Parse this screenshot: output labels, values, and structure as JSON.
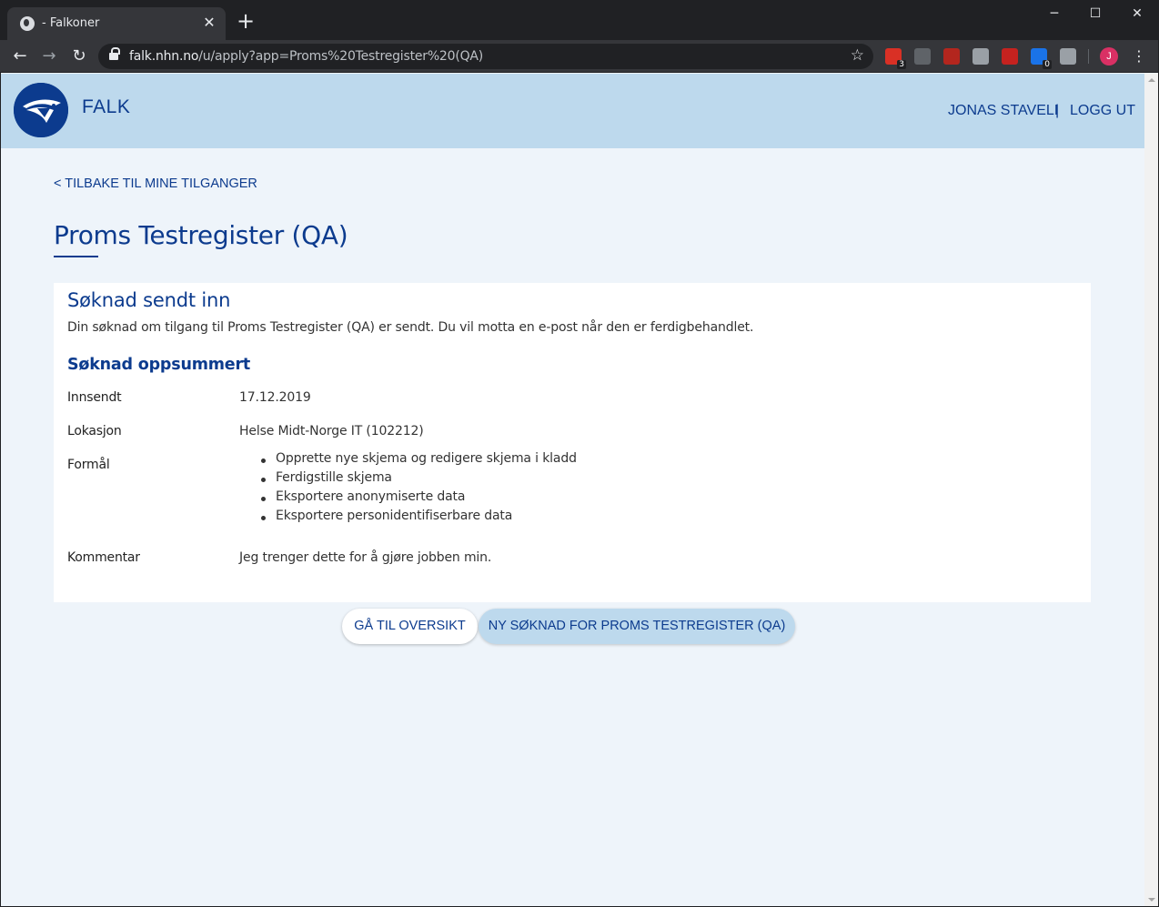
{
  "browser": {
    "tab_title": "- Falkoner",
    "tab_close": "✕",
    "new_tab": "+",
    "url_host": "falk.nhn.no",
    "url_path": "/u/apply?app=Proms%20Testregister%20(QA)",
    "window_controls": {
      "minimize": "─",
      "maximize": "☐",
      "close": "✕"
    },
    "nav": {
      "back": "←",
      "forward": "→",
      "reload": "↻"
    },
    "star": "☆",
    "extensions": [
      {
        "icon": "calendar-extension-icon",
        "color": "#d93025",
        "badge": "3"
      },
      {
        "icon": "grey-extension-icon",
        "color": "#5f6368",
        "badge": ""
      },
      {
        "icon": "pdf-extension-icon",
        "color": "#b3261e",
        "badge": ""
      },
      {
        "icon": "drive-extension-icon",
        "color": "#9aa0a6",
        "badge": ""
      },
      {
        "icon": "flag-extension-icon",
        "color": "#c5221f",
        "badge": ""
      },
      {
        "icon": "blue-extension-icon",
        "color": "#1a73e8",
        "badge": "0"
      },
      {
        "icon": "letter-extension-icon",
        "color": "#9aa0a6",
        "badge": ""
      }
    ],
    "profile_initial": "J",
    "menu": "⋮"
  },
  "header": {
    "brand": "FALK",
    "user_name": "JONAS STAVELI",
    "separator": "|",
    "logout": "LOGG UT"
  },
  "page": {
    "back_link": "< TILBAKE TIL MINE TILGANGER",
    "title": "Proms Testregister (QA)"
  },
  "card": {
    "title": "Søknad sendt inn",
    "description": "Din søknad om tilgang til Proms Testregister (QA) er sendt. Du vil motta en e-post når den er ferdigbehandlet.",
    "summary_title": "Søknad oppsummert",
    "submitted_label": "Innsendt",
    "submitted_value": "17.12.2019",
    "location_label": "Lokasjon",
    "location_value": "Helse Midt-Norge IT (102212)",
    "purpose_label": "Formål",
    "purposes": [
      "Opprette nye skjema og redigere skjema i kladd",
      "Ferdigstille skjema",
      "Eksportere anonymiserte data",
      "Eksportere personidentifiserbare data"
    ],
    "comment_label": "Kommentar",
    "comment_value": "Jeg trenger dette for å gjøre jobben min."
  },
  "buttons": {
    "overview": "GÅ TIL OVERSIKT",
    "new_application": "NY SØKNAD FOR PROMS TESTREGISTER (QA)"
  },
  "colors": {
    "brand_blue": "#0c3b8e",
    "header_bg": "#bdd9ed",
    "page_bg": "#eef4fa"
  }
}
